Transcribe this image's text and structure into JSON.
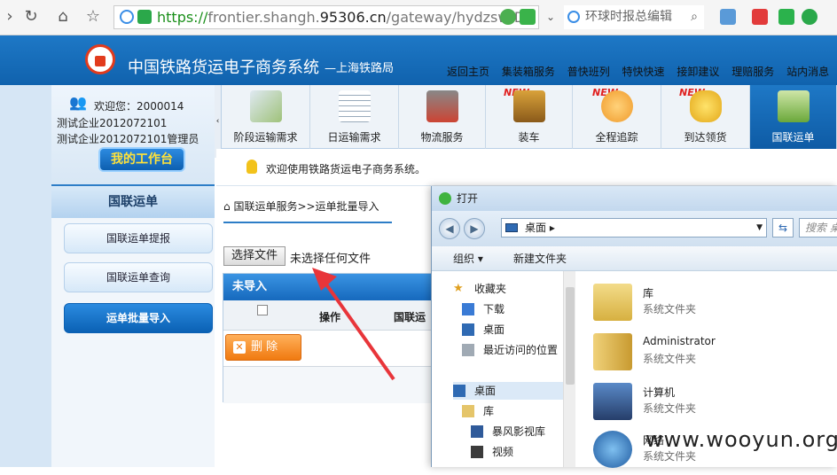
{
  "browser": {
    "url_scheme": "https://",
    "url_host_pre": "frontier.shangh.",
    "url_host_main": "95306.cn",
    "url_path": "/gateway/hydzsw/Dz",
    "search_text": "环球时报总编辑"
  },
  "site": {
    "title": "中国铁路货运电子商务系统",
    "subtitle": "—上海铁路局",
    "top_nav": [
      "返回主页",
      "集装箱服务",
      "普快班列",
      "特快快速",
      "接卸建议",
      "理赔服务",
      "站内消息"
    ]
  },
  "user": {
    "welcome": "欢迎您：2000014",
    "company": "测试企业2012072101",
    "role": "测试企业2012072101管理员",
    "workbench_label": "我的工作台"
  },
  "collapse_arrow": "‹",
  "tabs": [
    {
      "label": "阶段运输需求",
      "new": false
    },
    {
      "label": "日运输需求",
      "new": false
    },
    {
      "label": "物流服务",
      "new": false
    },
    {
      "label": "装车",
      "new": true
    },
    {
      "label": "全程追踪",
      "new": true
    },
    {
      "label": "到达领货",
      "new": true
    },
    {
      "label": "国联运单",
      "new": false,
      "active": true
    }
  ],
  "new_tag": "NEW",
  "notice": "欢迎使用铁路货运电子商务系统。",
  "sidebar": {
    "header": "国联运单",
    "items": [
      "国联运单提报",
      "国联运单查询",
      "运单批量导入"
    ]
  },
  "main": {
    "breadcrumb": "国联运单服务>>运单批量导入",
    "file_button": "选择文件",
    "file_status": "未选择任何文件",
    "panel_title": "未导入",
    "columns": [
      "操作",
      "国联运"
    ],
    "delete_label": "删 除"
  },
  "dialog": {
    "title": "打开",
    "address": "桌面",
    "search_placeholder": "搜索 桌",
    "organize": "组织 ▾",
    "new_folder": "新建文件夹",
    "nav": [
      {
        "label": "收藏夹",
        "level": 0
      },
      {
        "label": "下载",
        "level": 1
      },
      {
        "label": "桌面",
        "level": 1
      },
      {
        "label": "最近访问的位置",
        "level": 1
      },
      {
        "label": "桌面",
        "level": 0,
        "selected": true
      },
      {
        "label": "库",
        "level": 1
      },
      {
        "label": "暴风影视库",
        "level": 2
      },
      {
        "label": "视频",
        "level": 2
      }
    ],
    "files": [
      {
        "name": "库",
        "type": "系统文件夹"
      },
      {
        "name": "Administrator",
        "type": "系统文件夹"
      },
      {
        "name": "计算机",
        "type": "系统文件夹"
      },
      {
        "name": "网络",
        "type": "系统文件夹"
      }
    ]
  },
  "watermark": "www.wooyun.org",
  "colors": {
    "header_blue": "#1668b8",
    "accent_orange": "#f07a10",
    "arrow_red": "#e8353a"
  }
}
